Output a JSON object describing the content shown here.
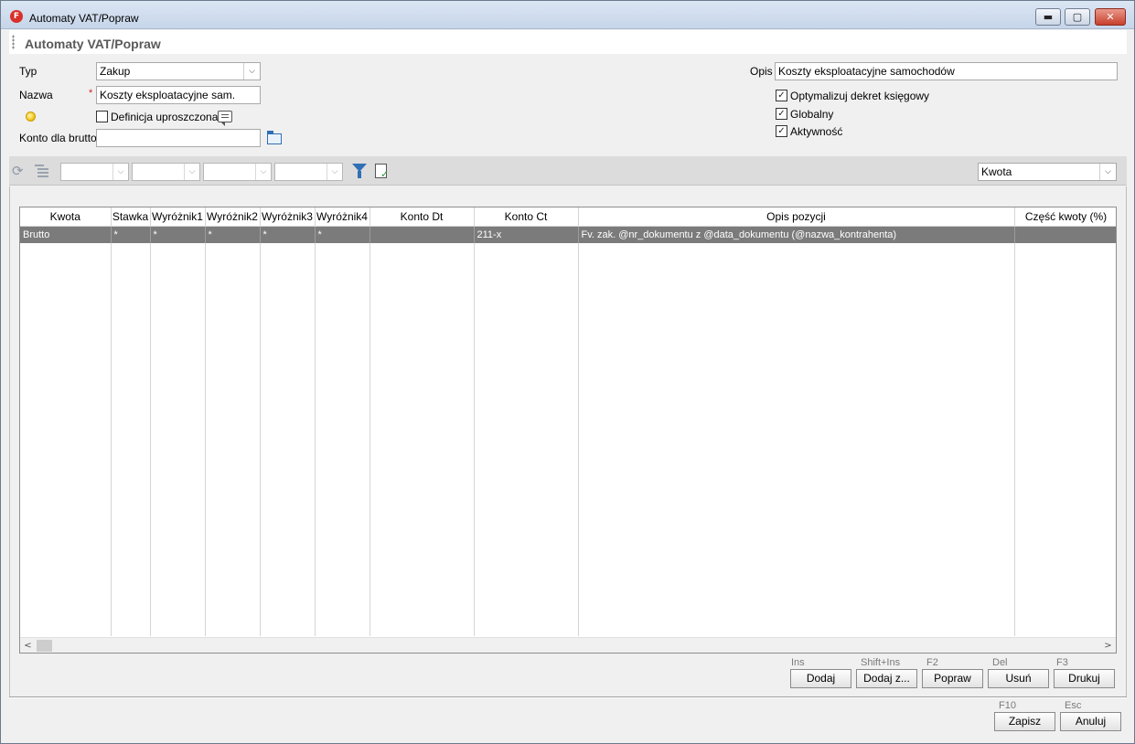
{
  "window": {
    "app_icon_letter": "F",
    "title": "Automaty VAT/Popraw",
    "minimize_glyph": "▬",
    "maximize_glyph": "▢",
    "close_glyph": "✕"
  },
  "form_header": {
    "title": "Automaty VAT/Popraw"
  },
  "form": {
    "typ_label": "Typ",
    "typ_value": "Zakup",
    "nazwa_label": "Nazwa",
    "required_mark": "*",
    "nazwa_value": "Koszty eksploatacyjne sam.",
    "definicja_label": "Definicja uproszczona",
    "definicja_checked": false,
    "konto_label": "Konto dla brutto",
    "konto_value": "",
    "opis_label": "Opis",
    "opis_value": "Koszty eksploatacyjne samochodów",
    "optymalizuj_label": "Optymalizuj dekret księgowy",
    "globalny_label": "Globalny",
    "aktywnosc_label": "Aktywność",
    "check_glyph": "✓"
  },
  "toolbar": {
    "refresh_glyph": "⟳",
    "sort_value": "Kwota",
    "dropdown_glyph": "⌵"
  },
  "grid": {
    "columns": [
      "Kwota",
      "Stawka",
      "Wyróżnik1",
      "Wyróżnik2",
      "Wyróżnik3",
      "Wyróżnik4",
      "Konto Dt",
      "Konto Ct",
      "Opis pozycji",
      "Część kwoty (%)"
    ],
    "rows": [
      [
        "Brutto",
        "*",
        "*",
        "*",
        "*",
        "*",
        "",
        "211-x",
        "Fv. zak. @nr_dokumentu z @data_dokumentu (@nazwa_kontrahenta)",
        ""
      ]
    ],
    "scroll_left": "<",
    "scroll_right": ">"
  },
  "actions": {
    "dodaj_key": "Ins",
    "dodaj_label": "Dodaj",
    "dodajz_key": "Shift+Ins",
    "dodajz_label": "Dodaj z...",
    "popraw_key": "F2",
    "popraw_label": "Popraw",
    "usun_key": "Del",
    "usun_label": "Usuń",
    "drukuj_key": "F3",
    "drukuj_label": "Drukuj"
  },
  "footer": {
    "zapisz_key": "F10",
    "zapisz_label": "Zapisz",
    "anuluj_key": "Esc",
    "anuluj_label": "Anuluj"
  }
}
